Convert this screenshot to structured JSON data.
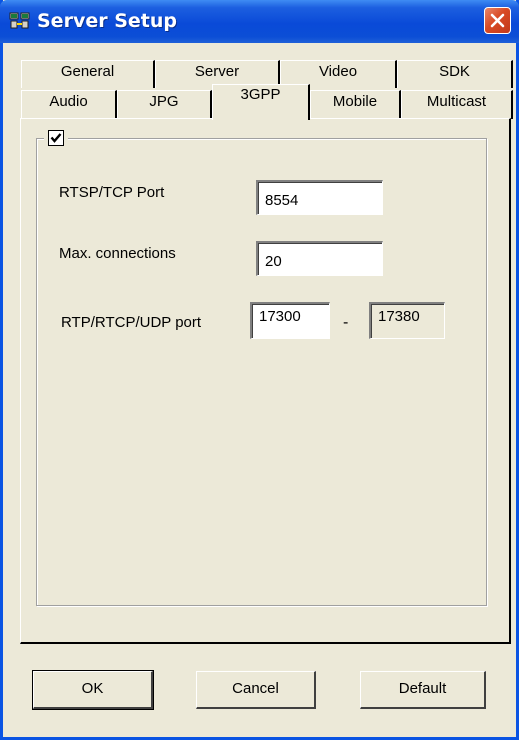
{
  "window": {
    "title": "Server Setup"
  },
  "tabs": {
    "row1": [
      "General",
      "Server",
      "Video",
      "SDK"
    ],
    "row2": [
      "Audio",
      "JPG",
      "3GPP",
      "Mobile",
      "Multicast"
    ],
    "selected": "3GPP"
  },
  "group": {
    "enable_checked": true
  },
  "form": {
    "rtsp_tcp_port_label": "RTSP/TCP Port",
    "rtsp_tcp_port_value": "8554",
    "max_connections_label": "Max. connections",
    "max_connections_value": "20",
    "rtp_port_label": "RTP/RTCP/UDP port",
    "rtp_port_start": "17300",
    "rtp_port_separator": "-",
    "rtp_port_end": "17380"
  },
  "buttons": {
    "ok": "OK",
    "cancel": "Cancel",
    "default": "Default"
  },
  "colors": {
    "titlebar": "#0a4ad8",
    "window_bg": "#ece9d8",
    "close_button": "#d84a24"
  }
}
